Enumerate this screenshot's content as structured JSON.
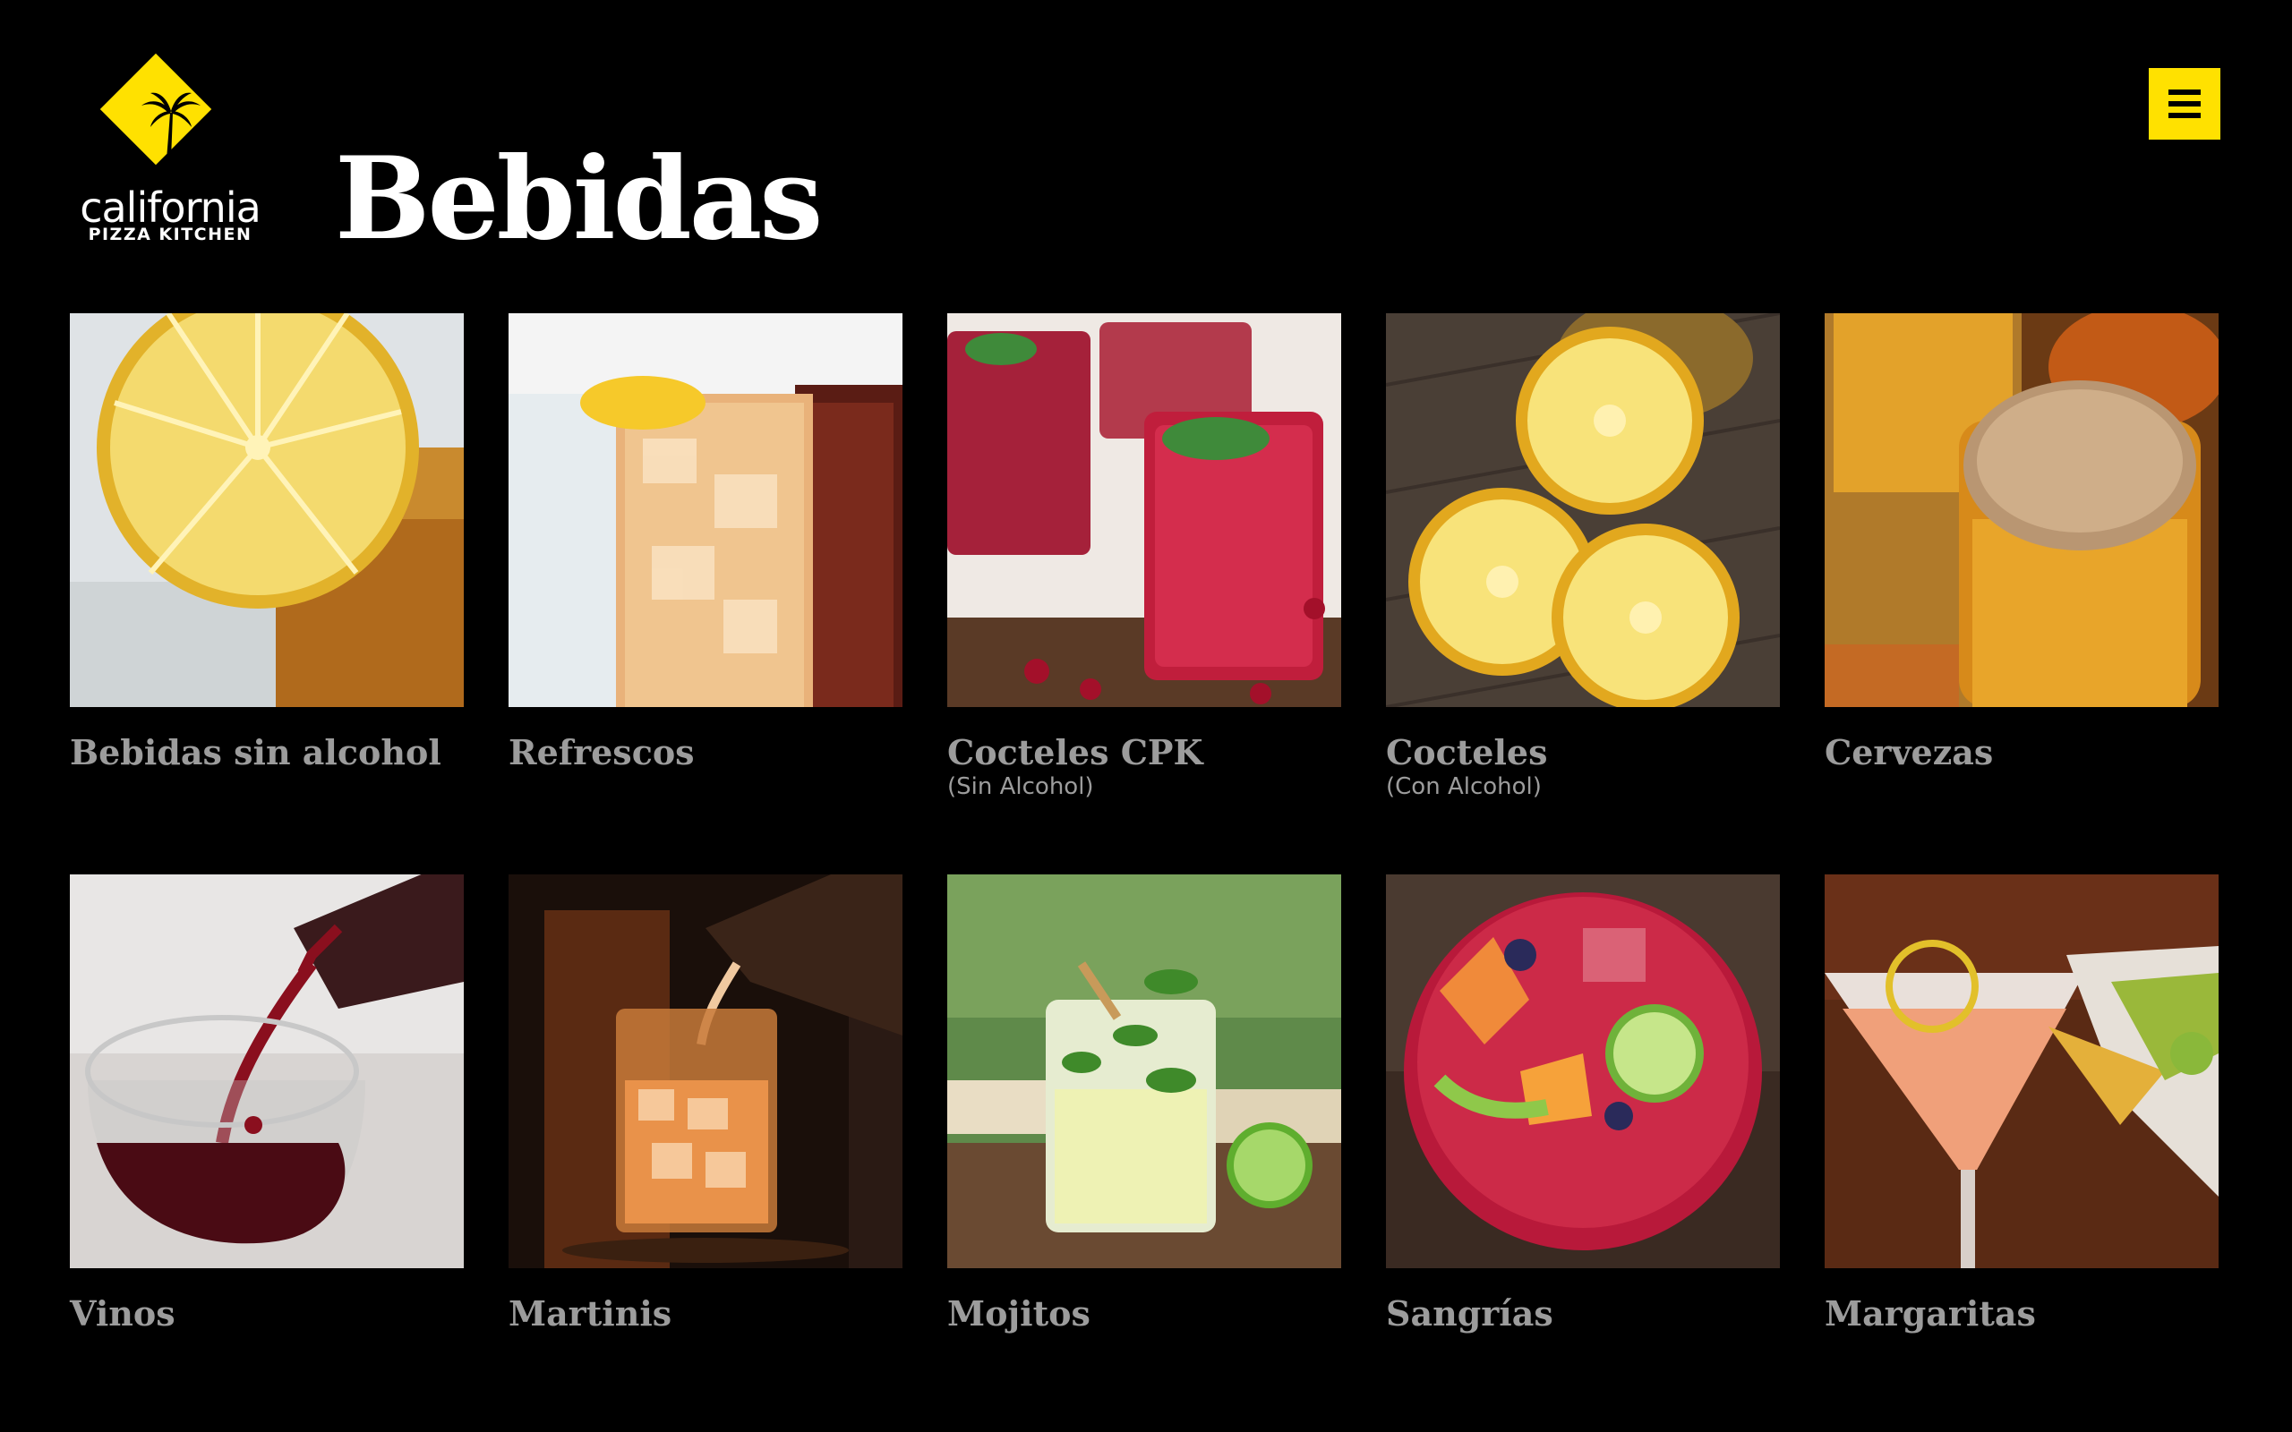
{
  "app": {
    "brand_name": "california",
    "brand_sub": "PIZZA KITCHEN",
    "page_title": "Bebidas"
  },
  "categories": [
    {
      "title": "Bebidas sin alcohol",
      "subtitle": ""
    },
    {
      "title": "Refrescos",
      "subtitle": ""
    },
    {
      "title": "Cocteles CPK",
      "subtitle": "(Sin Alcohol)"
    },
    {
      "title": "Cocteles",
      "subtitle": "(Con Alcohol)"
    },
    {
      "title": "Cervezas",
      "subtitle": ""
    },
    {
      "title": "Vinos",
      "subtitle": ""
    },
    {
      "title": "Martinis",
      "subtitle": ""
    },
    {
      "title": "Mojitos",
      "subtitle": ""
    },
    {
      "title": "Sangrías",
      "subtitle": ""
    },
    {
      "title": "Margaritas",
      "subtitle": ""
    }
  ],
  "icons": {
    "logo": "palm-tree-diamond-icon",
    "menu": "hamburger-menu-icon"
  },
  "colors": {
    "background": "#000000",
    "accent": "#ffe100",
    "tile_label": "#9c9c9c"
  }
}
